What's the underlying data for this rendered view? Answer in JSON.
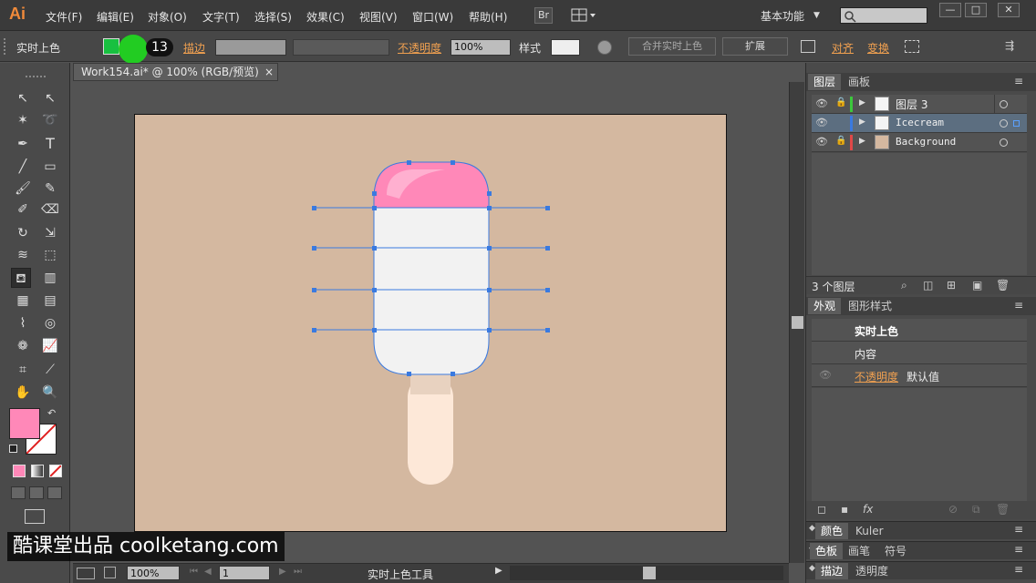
{
  "app": {
    "logo": "Ai",
    "menus": [
      "文件(F)",
      "编辑(E)",
      "对象(O)",
      "文字(T)",
      "选择(S)",
      "效果(C)",
      "视图(V)",
      "窗口(W)",
      "帮助(H)"
    ],
    "bridge_label": "Br",
    "workspace_label": "基本功能",
    "window_controls": [
      "—",
      "□",
      "✕"
    ]
  },
  "control_bar": {
    "tool_name": "实时上色",
    "stroke_label": "描边",
    "stroke_value": "13",
    "opacity_label": "不透明度",
    "opacity_value": "100%",
    "style_label": "样式",
    "merge_button": "合并实时上色",
    "expand_button": "扩展",
    "align_label": "对齐",
    "transform_label": "变换"
  },
  "document": {
    "tab_title": "Work154.ai* @ 100% (RGB/预览)",
    "tab_close": "×"
  },
  "layers_panel": {
    "tabs": [
      "图层",
      "画板"
    ],
    "layers": [
      {
        "name": "图层 3",
        "color": "#3cc83c",
        "selected": false
      },
      {
        "name": "Icecream",
        "color": "#3a7ae0",
        "selected": true
      },
      {
        "name": "Background",
        "color": "#e04848",
        "selected": false
      }
    ],
    "count_text": "3 个图层"
  },
  "appearance_panel": {
    "tabs": [
      "外观",
      "图形样式"
    ],
    "title_row": "实时上色",
    "content_row": "内容",
    "opacity_label": "不透明度",
    "opacity_value": "默认值"
  },
  "collapsed_panels": [
    {
      "tabs": [
        "颜色",
        "Kuler"
      ]
    },
    {
      "tabs": [
        "色板",
        "画笔",
        "符号"
      ]
    },
    {
      "tabs": [
        "描边",
        "透明度"
      ]
    }
  ],
  "status_bar": {
    "zoom": "100%",
    "page": "1",
    "tool_text": "实时上色工具"
  },
  "watermark": "酷课堂出品 coolketang.com",
  "colors": {
    "fill_swatch": "#ff88b8",
    "highlight": "#22cc22",
    "artboard": "#d4b8a0",
    "icecream_top": "#ff88b8",
    "icecream_body": "#f2f2f2",
    "stick": "#fde8d8",
    "selection": "#3a7ae0"
  }
}
